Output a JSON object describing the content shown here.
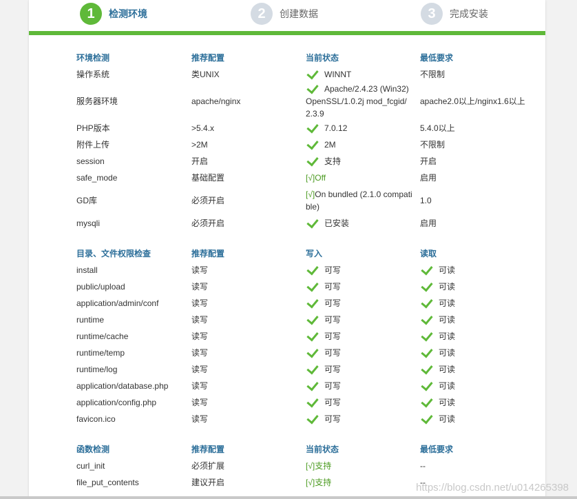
{
  "steps": [
    {
      "num": "1",
      "label": "检测环境",
      "active": true
    },
    {
      "num": "2",
      "label": "创建数据",
      "active": false
    },
    {
      "num": "3",
      "label": "完成安装",
      "active": false
    }
  ],
  "env": {
    "headers": [
      "环境检测",
      "推荐配置",
      "当前状态",
      "最低要求"
    ],
    "rows": [
      {
        "name": "操作系统",
        "rec": "类UNIX",
        "status": "WINNT",
        "min": "不限制"
      },
      {
        "name": "服务器环境",
        "rec": "apache/nginx",
        "status_line1": "Apache/2.4.23 (Win32)",
        "status_line2": "OpenSSL/1.0.2j mod_fcgid/",
        "status_line3": "2.3.9",
        "min": "apache2.0以上/nginx1.6以上"
      },
      {
        "name": "PHP版本",
        "rec": ">5.4.x",
        "status": "7.0.12",
        "min": "5.4.0以上"
      },
      {
        "name": "附件上传",
        "rec": ">2M",
        "status": "2M",
        "min": "不限制"
      },
      {
        "name": "session",
        "rec": "开启",
        "status": "支持",
        "min": "开启"
      },
      {
        "name": "safe_mode",
        "rec": "基础配置",
        "status_mark": "[√]",
        "status": "Off",
        "min": "启用"
      },
      {
        "name": "GD库",
        "rec": "必须开启",
        "status_mark": "[√]",
        "status_line1": "On bundled (2.1.0 compati",
        "status_line2": "ble)",
        "min": "1.0"
      },
      {
        "name": "mysqli",
        "rec": "必须开启",
        "status": "已安装",
        "min": "启用"
      }
    ]
  },
  "dirs": {
    "headers": [
      "目录、文件权限检查",
      "推荐配置",
      "写入",
      "读取"
    ],
    "write_label": "可写",
    "read_label": "可读",
    "rows": [
      {
        "name": "install",
        "rec": "读写"
      },
      {
        "name": "public/upload",
        "rec": "读写"
      },
      {
        "name": "application/admin/conf",
        "rec": "读写"
      },
      {
        "name": "runtime",
        "rec": "读写"
      },
      {
        "name": "runtime/cache",
        "rec": "读写"
      },
      {
        "name": "runtime/temp",
        "rec": "读写"
      },
      {
        "name": "runtime/log",
        "rec": "读写"
      },
      {
        "name": "application/database.php",
        "rec": "读写"
      },
      {
        "name": "application/config.php",
        "rec": "读写"
      },
      {
        "name": "favicon.ico",
        "rec": "读写"
      }
    ]
  },
  "funcs": {
    "headers": [
      "函数检测",
      "推荐配置",
      "当前状态",
      "最低要求"
    ],
    "rows": [
      {
        "name": "curl_init",
        "rec": "必须扩展",
        "mark": "[√]",
        "status": "支持",
        "min": "--"
      },
      {
        "name": "file_put_contents",
        "rec": "建议开启",
        "mark": "[√]",
        "status": "支持",
        "min": "--"
      }
    ]
  },
  "watermark": "https://blog.csdn.net/u014265398",
  "colors": {
    "accent_green": "#5fb939",
    "header_blue": "#2d6f9a",
    "inactive_step": "#d4dbe3"
  }
}
